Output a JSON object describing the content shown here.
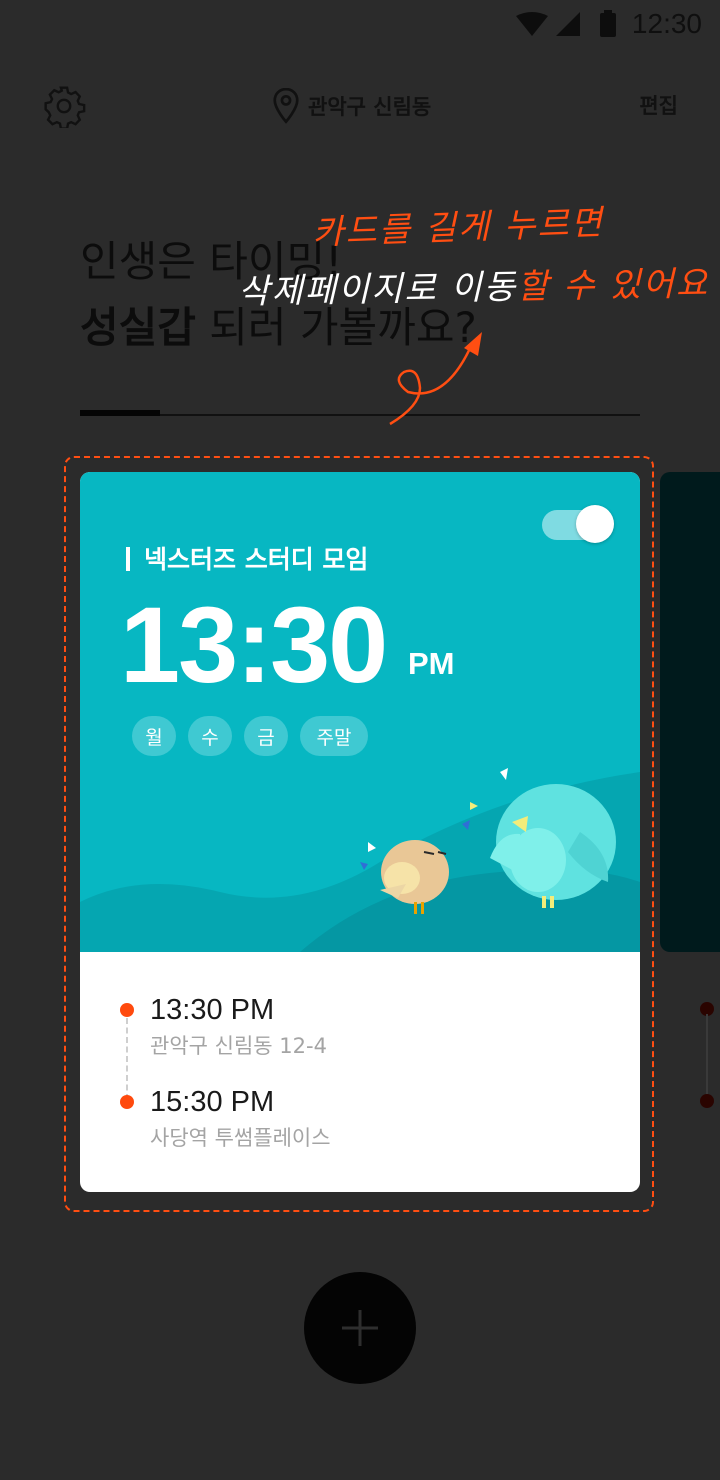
{
  "status_bar": {
    "time": "12:30"
  },
  "top_bar": {
    "settings_icon": "gear-icon",
    "location_icon": "location-pin-icon",
    "location": "관악구 신림동",
    "edit_label": "편집"
  },
  "headline": {
    "line1": "인생은 타이밍!",
    "line2_bold": "성실갑",
    "line2_rest": " 되러 가볼까요?"
  },
  "annotation": {
    "line1": "카드를 길게 누르면",
    "line2_white": "삭제페이지로 이동",
    "line2_orange": "할 수 있어요"
  },
  "alarm_card": {
    "enabled": true,
    "title": "넥스터즈 스터디 모임",
    "time": "13:30",
    "ampm": "PM",
    "days": [
      "월",
      "수",
      "금",
      "주말"
    ],
    "timeline": [
      {
        "time": "13:30 PM",
        "place": "관악구 신림동 12-4"
      },
      {
        "time": "15:30 PM",
        "place": "사당역 투썸플레이스"
      }
    ]
  },
  "colors": {
    "accent": "#ff4e12",
    "card_teal": "#07b7c2",
    "overlay_bg": "#2b2b2b"
  },
  "fab": {
    "icon": "plus-icon"
  }
}
